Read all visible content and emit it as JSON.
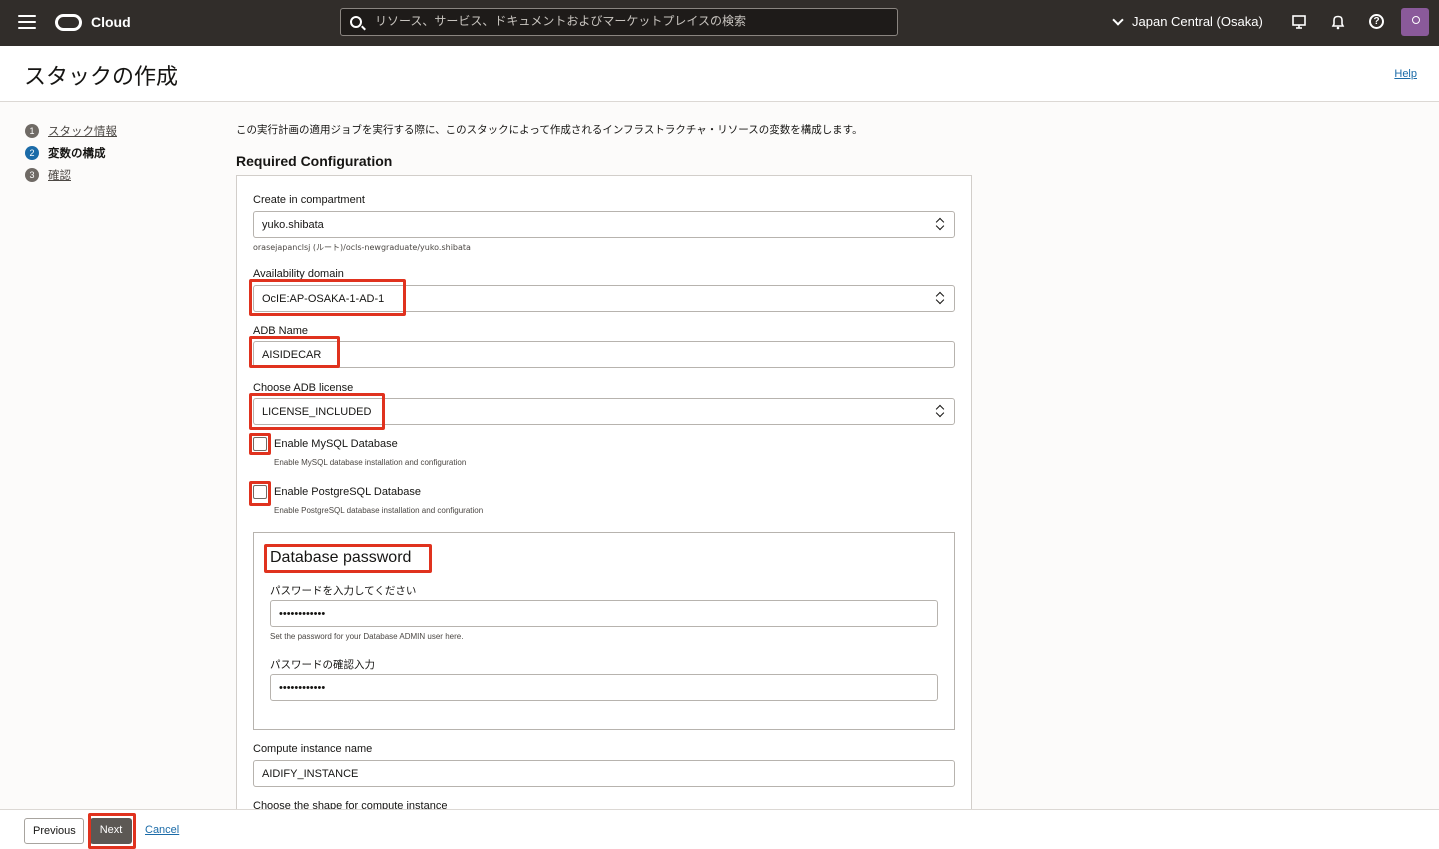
{
  "topbar": {
    "brand": "Cloud",
    "search_placeholder": "リソース、サービス、ドキュメントおよびマーケットプレイスの検索",
    "region": "Japan Central (Osaka)"
  },
  "header": {
    "title": "スタックの作成",
    "help": "Help"
  },
  "steps": [
    {
      "num": "1",
      "label": "スタック情報"
    },
    {
      "num": "2",
      "label": "変数の構成"
    },
    {
      "num": "3",
      "label": "確認"
    }
  ],
  "main": {
    "intro": "この実行計画の適用ジョブを実行する際に、このスタックによって作成されるインフラストラクチャ・リソースの変数を構成します。",
    "section_title": "Required Configuration",
    "compartment": {
      "label": "Create in compartment",
      "value": "yuko.shibata",
      "path": "orasejapanclsj (ルート)/ocls-newgraduate/yuko.shibata"
    },
    "availability_domain": {
      "label": "Availability domain",
      "value": "OcIE:AP-OSAKA-1-AD-1"
    },
    "adb_name": {
      "label": "ADB Name",
      "value": "AISIDECAR"
    },
    "adb_license": {
      "label": "Choose ADB license",
      "value": "LICENSE_INCLUDED"
    },
    "mysql": {
      "label": "Enable MySQL Database",
      "hint": "Enable MySQL database installation and configuration"
    },
    "postgres": {
      "label": "Enable PostgreSQL Database",
      "hint": "Enable PostgreSQL database installation and configuration"
    },
    "db_password": {
      "title": "Database password",
      "password_label": "パスワードを入力してください",
      "password_value": "••••••••••••",
      "password_hint": "Set the password for your Database ADMIN user here.",
      "confirm_label": "パスワードの確認入力",
      "confirm_value": "••••••••••••"
    },
    "compute_name": {
      "label": "Compute instance name",
      "value": "AIDIFY_INSTANCE"
    },
    "compute_shape_label": "Choose the shape for compute instance"
  },
  "footer": {
    "previous": "Previous",
    "next": "Next",
    "cancel": "Cancel"
  },
  "colors": {
    "topbar": "#312d2a",
    "accent": "#1b6ba8",
    "highlight": "#e0321e",
    "next_button": "#5c5854"
  }
}
